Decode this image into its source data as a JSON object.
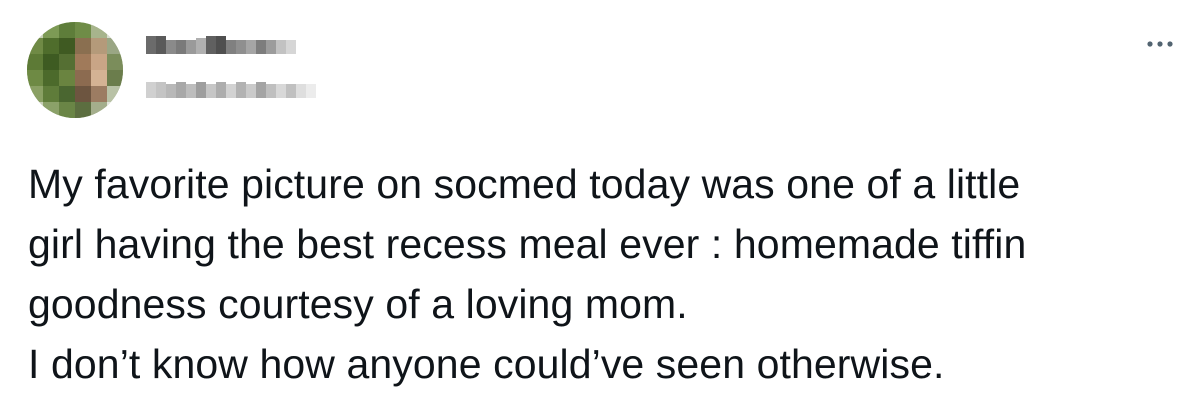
{
  "tweet": {
    "author_name": "",
    "author_handle": "",
    "more_icon": "more-horizontal-icon",
    "text_lines": [
      "My favorite picture on socmed today was one of a little",
      "girl having the best recess meal ever : homemade tiffin",
      "goodness courtesy of a loving mom.",
      "I don’t know how anyone could’ve seen otherwise."
    ]
  },
  "colors": {
    "text": "#0f1419",
    "background": "#ffffff",
    "icon": "#536471"
  }
}
